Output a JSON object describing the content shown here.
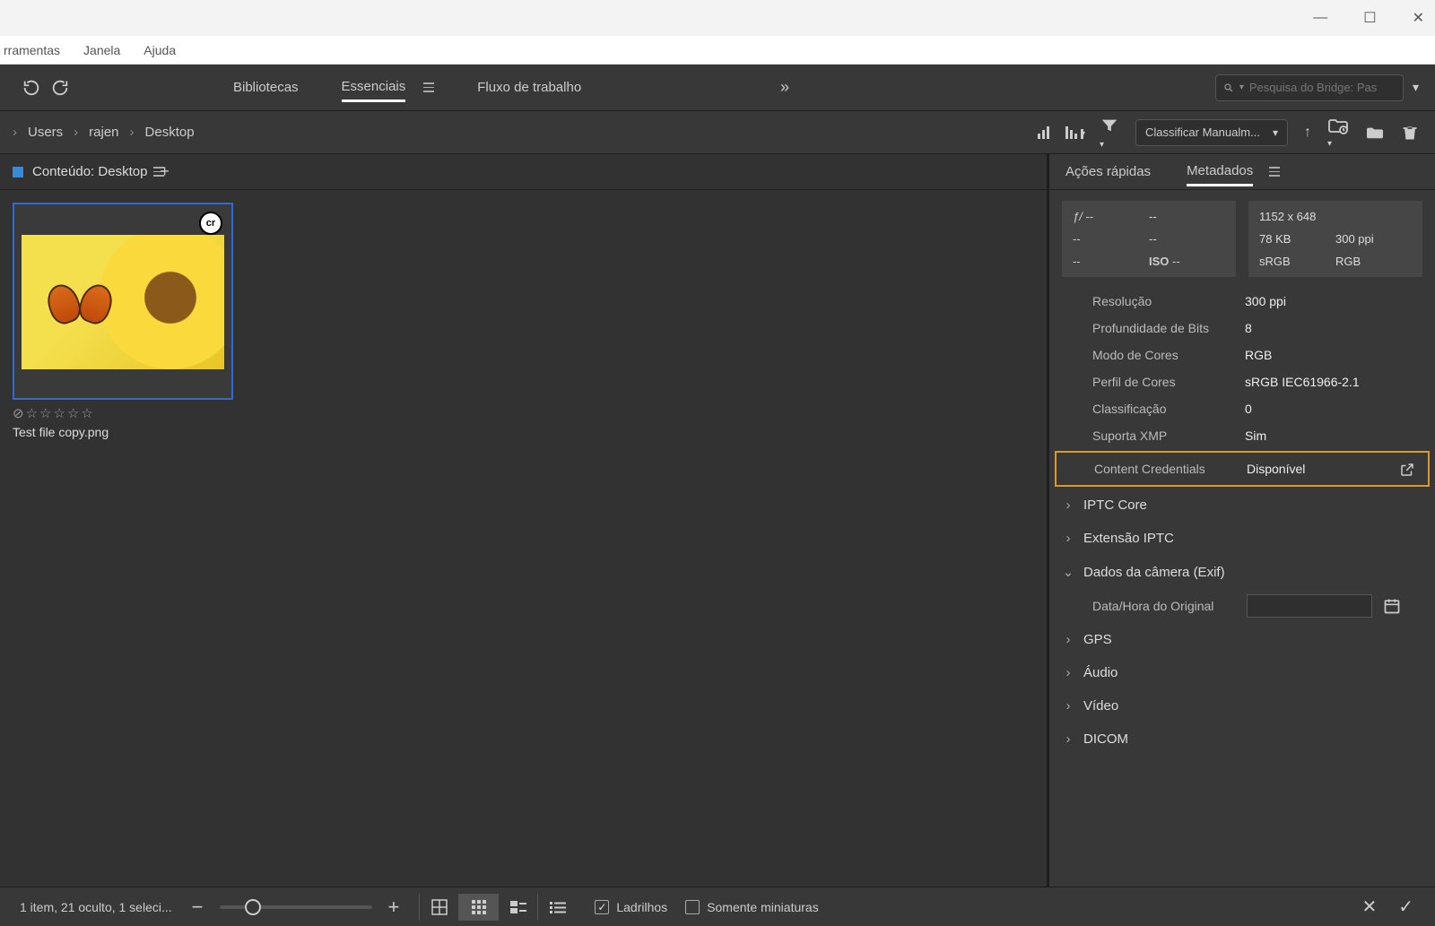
{
  "window_controls": {
    "min": "—",
    "max": "☐",
    "close": "✕"
  },
  "menubar": {
    "tools": "rramentas",
    "window": "Janela",
    "help": "Ajuda"
  },
  "toolbar1": {
    "ws1": "Bibliotecas",
    "ws2": "Essenciais",
    "ws3": "Fluxo de trabalho",
    "more": "»",
    "search_placeholder": "Pesquisa do Bridge: Pas"
  },
  "breadcrumb": {
    "p1": "Users",
    "p2": "rajen",
    "p3": "Desktop",
    "sep": "›"
  },
  "toolbar2": {
    "sort": "Classificar Manualm..."
  },
  "content": {
    "header": "Conteúdo: Desktop",
    "thumb_badge": "cr",
    "thumb_name": "Test file copy.png"
  },
  "right": {
    "tab1": "Ações rápidas",
    "tab2": "Metadados",
    "box1": {
      "f": "ƒ/",
      "fval": "--",
      "exp": "--",
      "wb": "--",
      "wbval": "--",
      "iso_lbl": "ISO",
      "iso": "--"
    },
    "box2": {
      "dims": "1152 x 648",
      "size": "78 KB",
      "ppi": "300 ppi",
      "cs": "sRGB",
      "mode": "RGB"
    },
    "rows": [
      {
        "k": "Resolução",
        "v": "300 ppi"
      },
      {
        "k": "Profundidade de Bits",
        "v": "8"
      },
      {
        "k": "Modo de Cores",
        "v": "RGB"
      },
      {
        "k": "Perfil de Cores",
        "v": "sRGB IEC61966-2.1"
      },
      {
        "k": "Classificação",
        "v": "0"
      },
      {
        "k": "Suporta XMP",
        "v": "Sim"
      }
    ],
    "cc_k": "Content Credentials",
    "cc_v": "Disponível",
    "sections": {
      "iptc": "IPTC Core",
      "iptc_ext": "Extensão IPTC",
      "exif": "Dados da câmera (Exif)",
      "exif_field": "Data/Hora do Original",
      "gps": "GPS",
      "audio": "Áudio",
      "video": "Vídeo",
      "dicom": "DICOM"
    }
  },
  "statusbar": {
    "info": "1 item, 21 oculto, 1 seleci...",
    "opt1": "Ladrilhos",
    "opt2": "Somente miniaturas"
  }
}
